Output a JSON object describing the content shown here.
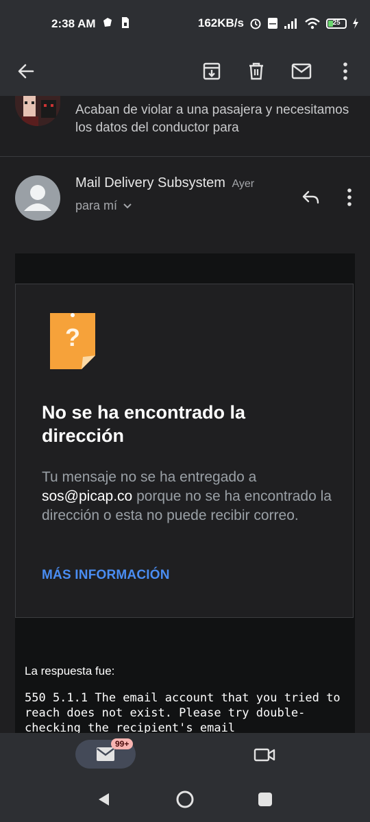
{
  "status_bar": {
    "time": "2:38 AM",
    "net_speed": "162KB/s",
    "battery_level": "25",
    "battery_fraction": 0.25
  },
  "app_bar": {
    "icons": [
      "back-arrow-icon",
      "archive-icon",
      "trash-icon",
      "mail-unread-icon",
      "more-vertical-icon"
    ]
  },
  "previous_message": {
    "snippet": "Acaban de violar a una pasajera y necesitamos los datos del conductor para"
  },
  "message": {
    "sender": "Mail Delivery Subsystem",
    "date": "Ayer",
    "recipient": "para mí"
  },
  "bounce_card": {
    "title": "No se ha encontrado la dirección",
    "text_before": "Tu mensaje no se ha entregado a",
    "email": "sos@picap.co",
    "text_after": "porque no se ha encontrado la dirección o esta no puede recibir correo.",
    "link": "MÁS INFORMACIÓN"
  },
  "response": {
    "label": "La respuesta fue:",
    "text": "550 5.1.1 The email account that you tried to reach does not exist. Please try double-checking the recipient's email"
  },
  "bottom_nav": {
    "mail_badge": "99+"
  },
  "colors": {
    "background": "#1f1f21",
    "bar": "#2d2f33",
    "link": "#4a8df2",
    "note_icon": "#f6a23a",
    "badge": "#f8b4b1"
  }
}
